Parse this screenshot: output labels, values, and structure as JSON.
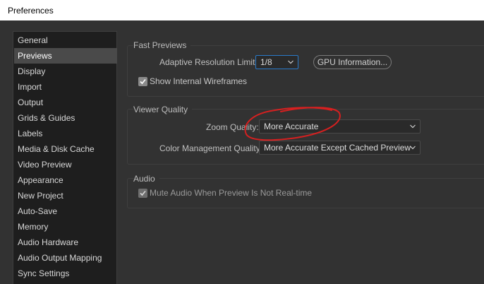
{
  "window": {
    "title": "Preferences"
  },
  "sidebar": {
    "items": [
      {
        "label": "General",
        "selected": false
      },
      {
        "label": "Previews",
        "selected": true
      },
      {
        "label": "Display",
        "selected": false
      },
      {
        "label": "Import",
        "selected": false
      },
      {
        "label": "Output",
        "selected": false
      },
      {
        "label": "Grids & Guides",
        "selected": false
      },
      {
        "label": "Labels",
        "selected": false
      },
      {
        "label": "Media & Disk Cache",
        "selected": false
      },
      {
        "label": "Video Preview",
        "selected": false
      },
      {
        "label": "Appearance",
        "selected": false
      },
      {
        "label": "New Project",
        "selected": false
      },
      {
        "label": "Auto-Save",
        "selected": false
      },
      {
        "label": "Memory",
        "selected": false
      },
      {
        "label": "Audio Hardware",
        "selected": false
      },
      {
        "label": "Audio Output Mapping",
        "selected": false
      },
      {
        "label": "Sync Settings",
        "selected": false
      }
    ]
  },
  "fast_previews": {
    "title": "Fast Previews",
    "adaptive_label": "Adaptive Resolution Limit:",
    "adaptive_value": "1/8",
    "gpu_button": "GPU Information...",
    "show_wireframes_label": "Show Internal Wireframes",
    "show_wireframes_checked": true
  },
  "viewer_quality": {
    "title": "Viewer Quality",
    "zoom_label": "Zoom Quality:",
    "zoom_value": "More Accurate",
    "color_label": "Color Management Quality:",
    "color_value": "More Accurate Except Cached Preview"
  },
  "audio": {
    "title": "Audio",
    "mute_label": "Mute Audio When Preview Is Not Real-time",
    "mute_checked": true
  },
  "colors": {
    "panel_bg": "#323232",
    "sidebar_bg": "#1e1e1e",
    "selected_bg": "#4a4a4a",
    "focus_border": "#2a7ac9",
    "annotation": "#d62020"
  }
}
